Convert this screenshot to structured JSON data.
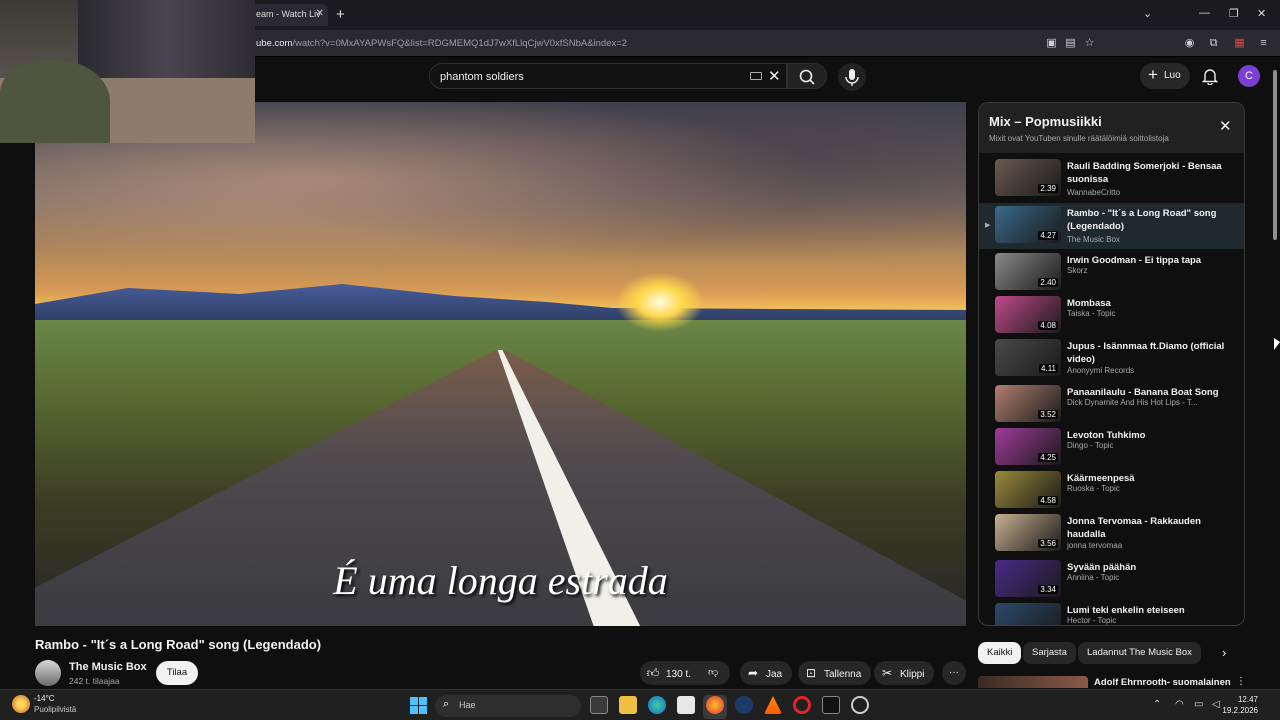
{
  "browser": {
    "tab_title": "eam - Watch Liv",
    "url_prefix": "ube.com",
    "url_path": "/watch?v=0MxAYAPWsFQ&list=RDGMEMQ1dJ7wXfLlqCjwV0xfSNbA&index=2"
  },
  "header": {
    "search_value": "phantom soldiers",
    "create_label": "Luo",
    "avatar_letter": "C"
  },
  "video": {
    "subtitle_text": "É uma longa estrada",
    "title": "Rambo - \"It´s a Long Road\" song (Legendado)",
    "channel_name": "The Music Box",
    "subscriber_count": "242 t. tilaajaa",
    "subscribe_label": "Tilaa",
    "like_count": "130 t.",
    "share_label": "Jaa",
    "save_label": "Tallenna",
    "clip_label": "Klippi"
  },
  "playlist": {
    "title": "Mix – Popmusiikki",
    "subtitle": "Mixit ovat YouTuben sinulle räätälöimiä soittolistoja",
    "items": [
      {
        "title": "Rauli Badding Somerjoki - Bensaa suonissa",
        "channel": "WannabeCritto",
        "duration": "2.39",
        "thumb_color": "#6a5a50"
      },
      {
        "title": "Rambo - \"It´s a Long Road\" song (Legendado)",
        "channel": "The Music Box",
        "duration": "4.27",
        "thumb_color": "#3a6a8a"
      },
      {
        "title": "Irwin Goodman - Ei tippa tapa",
        "channel": "Skorz",
        "duration": "2.40",
        "thumb_color": "#8a8a8a"
      },
      {
        "title": "Mombasa",
        "channel": "Taiska - Topic",
        "duration": "4.08",
        "thumb_color": "#c04a8a"
      },
      {
        "title": "Jupus - Isännmaa ft.Diamo (official video)",
        "channel": "Anonyymi Records",
        "duration": "4.11",
        "thumb_color": "#4a4a4a"
      },
      {
        "title": "Panaanilaulu - Banana Boat Song",
        "channel": "Dick Dynamite And His Hot Lips - T...",
        "duration": "3.52",
        "thumb_color": "#b08070"
      },
      {
        "title": "Levoton Tuhkimo",
        "channel": "Dingo - Topic",
        "duration": "4.25",
        "thumb_color": "#a03a9a"
      },
      {
        "title": "Käärmeenpesä",
        "channel": "Ruoska - Topic",
        "duration": "4.58",
        "thumb_color": "#9a8a3a"
      },
      {
        "title": "Jonna Tervomaa - Rakkauden haudalla",
        "channel": "jonna tervomaa",
        "duration": "3.56",
        "thumb_color": "#c8b090"
      },
      {
        "title": "Syvään päähän",
        "channel": "Anniina - Topic",
        "duration": "3.34",
        "thumb_color": "#4a2a8a"
      },
      {
        "title": "Lumi teki enkelin eteiseen",
        "channel": "Hector - Topic",
        "duration": "3.28",
        "thumb_color": "#2a4a6a"
      }
    ]
  },
  "chips": [
    "Kaikki",
    "Sarjasta",
    "Ladannut The Music Box"
  ],
  "next_recommendation": "Adolf Ehrnrooth- suomalainen",
  "taskbar": {
    "temperature": "-14°C",
    "weather": "Puolipilvistä",
    "search_placeholder": "Hae",
    "time": "12.47",
    "date": "19.2.2026"
  }
}
